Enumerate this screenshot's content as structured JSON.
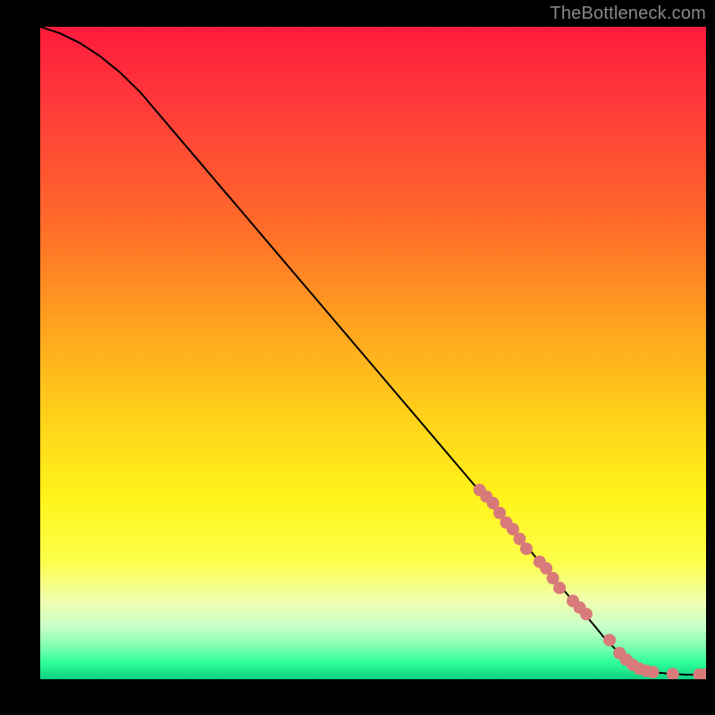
{
  "attribution": "TheBottleneck.com",
  "chart_data": {
    "type": "line",
    "title": "",
    "xlabel": "",
    "ylabel": "",
    "xlim": [
      0,
      100
    ],
    "ylim": [
      0,
      100
    ],
    "grid": false,
    "series": [
      {
        "name": "curve",
        "x": [
          0,
          3,
          6,
          9,
          12,
          15,
          20,
          30,
          40,
          50,
          60,
          70,
          75,
          80,
          83,
          85,
          87,
          89,
          91,
          93,
          95,
          97,
          100
        ],
        "y": [
          100,
          99,
          97.5,
          95.5,
          93,
          90,
          84,
          72,
          60,
          48,
          36,
          24,
          18,
          12,
          8.5,
          6,
          4,
          2.5,
          1.5,
          1,
          0.8,
          0.7,
          0.7
        ]
      }
    ],
    "points": {
      "name": "markers",
      "color": "#d97a7a",
      "xy": [
        [
          66,
          29
        ],
        [
          67,
          28
        ],
        [
          68,
          27
        ],
        [
          69,
          25.5
        ],
        [
          70,
          24
        ],
        [
          71,
          23
        ],
        [
          72,
          21.5
        ],
        [
          73,
          20
        ],
        [
          75,
          18
        ],
        [
          76,
          17
        ],
        [
          77,
          15.5
        ],
        [
          78,
          14
        ],
        [
          80,
          12
        ],
        [
          81,
          11
        ],
        [
          82,
          10
        ],
        [
          85.5,
          6
        ],
        [
          87,
          4
        ],
        [
          88,
          3
        ],
        [
          89,
          2.2
        ],
        [
          90,
          1.6
        ],
        [
          91,
          1.3
        ],
        [
          92,
          1.1
        ],
        [
          95,
          0.8
        ],
        [
          99,
          0.7
        ],
        [
          100,
          0.7
        ]
      ]
    },
    "gradient_stops": [
      {
        "offset": 0.0,
        "color": "#ff1a3c"
      },
      {
        "offset": 0.12,
        "color": "#ff3a3a"
      },
      {
        "offset": 0.3,
        "color": "#ff6a2a"
      },
      {
        "offset": 0.45,
        "color": "#ffa01f"
      },
      {
        "offset": 0.6,
        "color": "#ffd21a"
      },
      {
        "offset": 0.72,
        "color": "#fff31a"
      },
      {
        "offset": 0.82,
        "color": "#fdff4a"
      },
      {
        "offset": 0.88,
        "color": "#f0ffb0"
      },
      {
        "offset": 0.92,
        "color": "#c8ffc8"
      },
      {
        "offset": 0.95,
        "color": "#7effb0"
      },
      {
        "offset": 0.975,
        "color": "#2eff9a"
      },
      {
        "offset": 1.0,
        "color": "#10d080"
      }
    ]
  }
}
